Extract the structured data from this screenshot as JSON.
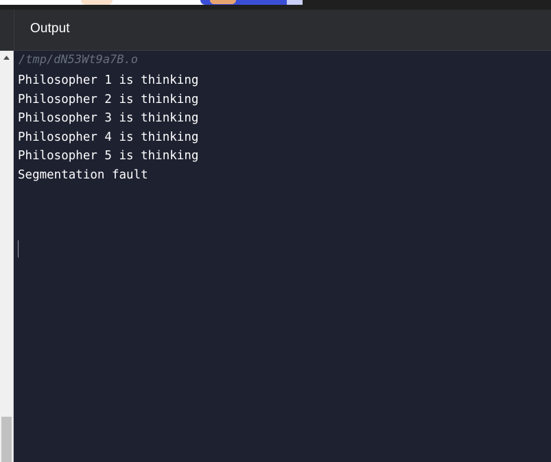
{
  "header": {
    "title": "Output"
  },
  "console": {
    "path": "/tmp/dN53Wt9a7B.o",
    "lines": [
      "Philosopher 1 is thinking",
      "Philosopher 2 is thinking",
      "Philosopher 3 is thinking",
      "Philosopher 4 is thinking",
      "Philosopher 5 is thinking",
      "Segmentation fault"
    ]
  },
  "scrollbar": {
    "up_icon": "chevron-up-icon"
  },
  "colors": {
    "console_bg": "#1d2130",
    "header_bg": "#2c2d30",
    "text": "#ffffff",
    "path_text": "#6a6f7c"
  }
}
